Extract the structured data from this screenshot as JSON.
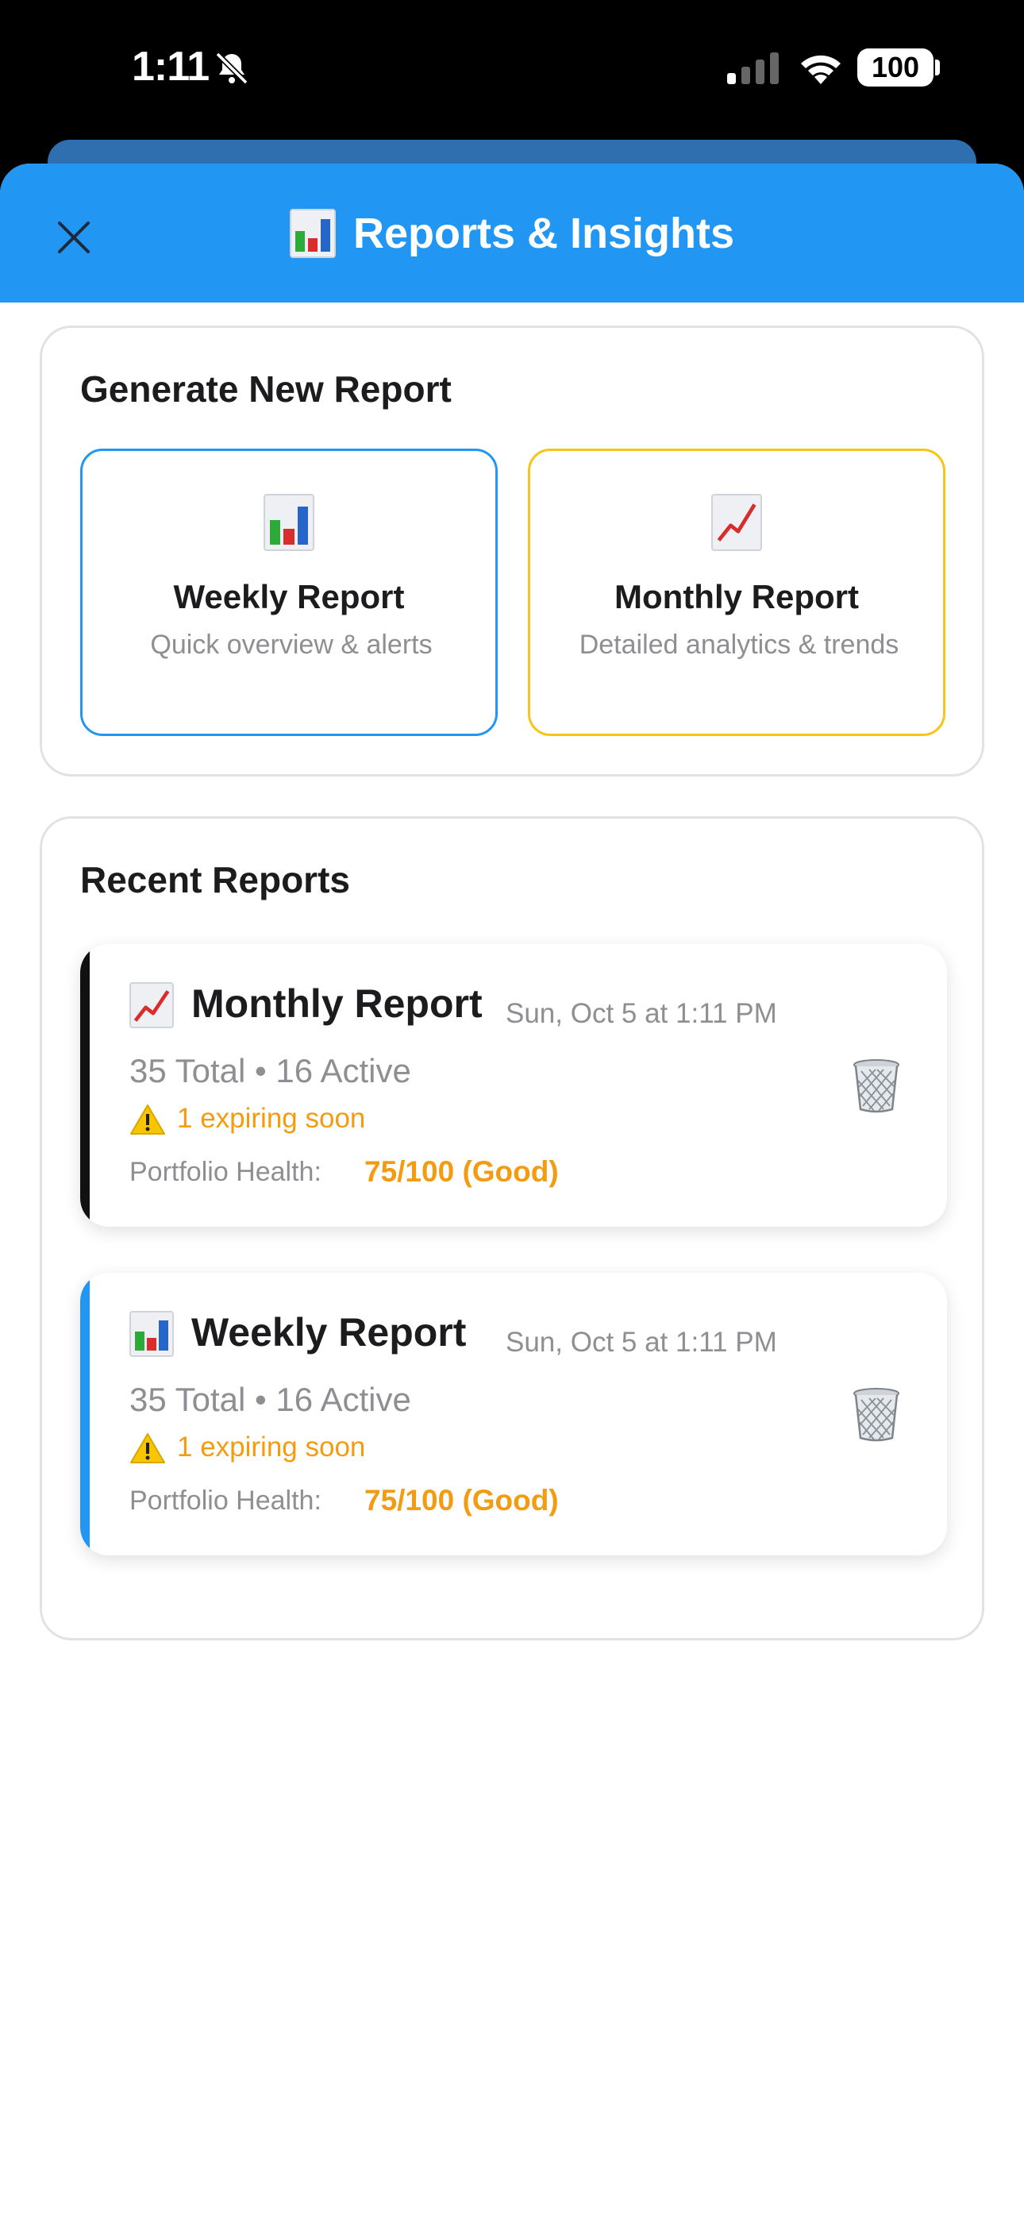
{
  "status_bar": {
    "time": "1:11",
    "battery": "100"
  },
  "header": {
    "title": "Reports & Insights"
  },
  "generate": {
    "heading": "Generate New Report",
    "options": [
      {
        "title": "Weekly Report",
        "description": "Quick overview & alerts",
        "icon": "bar-chart-icon"
      },
      {
        "title": "Monthly Report",
        "description": "Detailed analytics & trends",
        "icon": "chart-increasing-icon"
      }
    ]
  },
  "recent": {
    "heading": "Recent Reports",
    "items": [
      {
        "title": "Monthly Report",
        "date": "Sun, Oct 5 at 1:11 PM",
        "counts": "35 Total • 16 Active",
        "warning": "1 expiring soon",
        "health_label": "Portfolio Health:",
        "health_value": "75/100 (Good)",
        "icon": "chart-increasing-icon"
      },
      {
        "title": "Weekly Report",
        "date": "Sun, Oct 5 at 1:11 PM",
        "counts": "35 Total • 16 Active",
        "warning": "1 expiring soon",
        "health_label": "Portfolio Health:",
        "health_value": "75/100 (Good)",
        "icon": "bar-chart-icon"
      }
    ]
  },
  "colors": {
    "header": "#2196F3",
    "weekly_accent": "#2196F3",
    "monthly_border": "#F5C518",
    "warning": "#F39C12"
  }
}
